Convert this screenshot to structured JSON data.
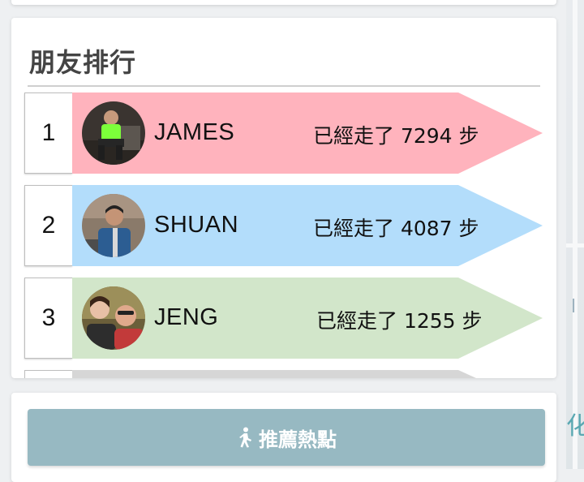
{
  "ranking": {
    "title": "朋友排行",
    "rows": [
      {
        "rank": "1",
        "name": "JAMES",
        "steps_text": "已經走了 7294 步",
        "color": "#ffb3bd"
      },
      {
        "rank": "2",
        "name": "SHUAN",
        "steps_text": "已經走了 4087 步",
        "color": "#b3ddfb"
      },
      {
        "rank": "3",
        "name": "JENG",
        "steps_text": "已經走了 1255 步",
        "color": "#d2e6ca"
      }
    ]
  },
  "actions": {
    "hot_spots_label": "推薦熱點",
    "hot_spots_icon": "walking-person-icon",
    "button_color": "#97b9c2"
  },
  "map_edge_text": {
    "top_glyph": "l",
    "bottom_glyph": "化"
  }
}
